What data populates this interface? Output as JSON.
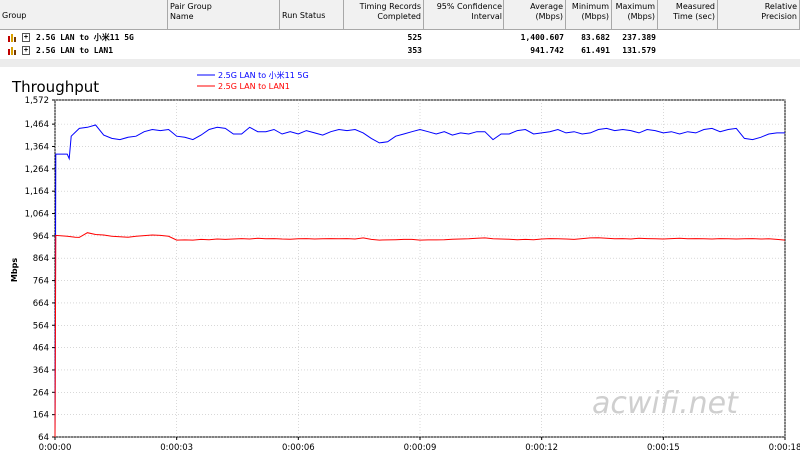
{
  "table": {
    "columns": [
      "Group",
      "Pair Group Name",
      "Run Status",
      "Timing Records Completed",
      "95% Confidence Interval",
      "Average (Mbps)",
      "Minimum (Mbps)",
      "Maximum (Mbps)",
      "Measured Time (sec)",
      "Relative Precision"
    ],
    "rows": [
      {
        "name": "2.5G LAN to 小米11 5G",
        "expand": "+",
        "records": "525",
        "average": "1,400.607",
        "minimum": "83.682",
        "maximum": "237.389"
      },
      {
        "name": "2.5G LAN to LAN1",
        "expand": "+",
        "records": "353",
        "average": "941.742",
        "minimum": "61.491",
        "maximum": "131.579"
      }
    ]
  },
  "chart_data": {
    "type": "line",
    "title": "Throughput",
    "xlabel": "",
    "ylabel": "Mbps",
    "ylim": [
      64,
      1572
    ],
    "yticks": [
      "1,572",
      "1,464",
      "1,364",
      "1,264",
      "1,164",
      "1,064",
      "964",
      "864",
      "764",
      "664",
      "564",
      "464",
      "364",
      "264",
      "164",
      "64"
    ],
    "xticks": [
      "0:00:00",
      "0:00:03",
      "0:00:06",
      "0:00:09",
      "0:00:12",
      "0:00:15",
      "0:00:18"
    ],
    "legend_position": "top-center",
    "grid": true,
    "series": [
      {
        "name": "2.5G LAN to 小米11 5G",
        "color": "#0000ff",
        "points": [
          [
            0,
            64
          ],
          [
            0.02,
            1330
          ],
          [
            0.3,
            1330
          ],
          [
            0.35,
            1310
          ],
          [
            0.4,
            1410
          ],
          [
            0.6,
            1445
          ],
          [
            0.8,
            1450
          ],
          [
            1.0,
            1460
          ],
          [
            1.2,
            1415
          ],
          [
            1.4,
            1400
          ],
          [
            1.6,
            1395
          ],
          [
            1.8,
            1405
          ],
          [
            2.0,
            1410
          ],
          [
            2.2,
            1430
          ],
          [
            2.4,
            1440
          ],
          [
            2.6,
            1435
          ],
          [
            2.8,
            1440
          ],
          [
            3.0,
            1410
          ],
          [
            3.2,
            1405
          ],
          [
            3.4,
            1395
          ],
          [
            3.6,
            1415
          ],
          [
            3.8,
            1440
          ],
          [
            4.0,
            1450
          ],
          [
            4.2,
            1445
          ],
          [
            4.4,
            1420
          ],
          [
            4.6,
            1420
          ],
          [
            4.8,
            1450
          ],
          [
            5.0,
            1430
          ],
          [
            5.2,
            1430
          ],
          [
            5.4,
            1440
          ],
          [
            5.6,
            1420
          ],
          [
            5.8,
            1430
          ],
          [
            6.0,
            1420
          ],
          [
            6.2,
            1435
          ],
          [
            6.4,
            1425
          ],
          [
            6.6,
            1415
          ],
          [
            6.8,
            1430
          ],
          [
            7.0,
            1440
          ],
          [
            7.2,
            1435
          ],
          [
            7.4,
            1440
          ],
          [
            7.6,
            1425
          ],
          [
            7.8,
            1400
          ],
          [
            8.0,
            1380
          ],
          [
            8.2,
            1385
          ],
          [
            8.4,
            1410
          ],
          [
            8.6,
            1420
          ],
          [
            8.8,
            1430
          ],
          [
            9.0,
            1440
          ],
          [
            9.2,
            1430
          ],
          [
            9.4,
            1420
          ],
          [
            9.6,
            1430
          ],
          [
            9.8,
            1415
          ],
          [
            10.0,
            1425
          ],
          [
            10.2,
            1420
          ],
          [
            10.4,
            1430
          ],
          [
            10.6,
            1430
          ],
          [
            10.8,
            1395
          ],
          [
            11.0,
            1420
          ],
          [
            11.2,
            1420
          ],
          [
            11.4,
            1435
          ],
          [
            11.6,
            1440
          ],
          [
            11.8,
            1420
          ],
          [
            12.0,
            1425
          ],
          [
            12.2,
            1430
          ],
          [
            12.4,
            1440
          ],
          [
            12.6,
            1425
          ],
          [
            12.8,
            1430
          ],
          [
            13.0,
            1420
          ],
          [
            13.2,
            1425
          ],
          [
            13.4,
            1440
          ],
          [
            13.6,
            1445
          ],
          [
            13.8,
            1435
          ],
          [
            14.0,
            1440
          ],
          [
            14.2,
            1435
          ],
          [
            14.4,
            1425
          ],
          [
            14.6,
            1440
          ],
          [
            14.8,
            1435
          ],
          [
            15.0,
            1425
          ],
          [
            15.2,
            1430
          ],
          [
            15.4,
            1420
          ],
          [
            15.6,
            1430
          ],
          [
            15.8,
            1425
          ],
          [
            16.0,
            1440
          ],
          [
            16.2,
            1445
          ],
          [
            16.4,
            1430
          ],
          [
            16.6,
            1440
          ],
          [
            16.8,
            1445
          ],
          [
            17.0,
            1400
          ],
          [
            17.2,
            1395
          ],
          [
            17.4,
            1405
          ],
          [
            17.6,
            1420
          ],
          [
            17.8,
            1425
          ],
          [
            18.0,
            1425
          ]
        ]
      },
      {
        "name": "2.5G LAN to LAN1",
        "color": "#ff0000",
        "points": [
          [
            0,
            64
          ],
          [
            0.02,
            966
          ],
          [
            0.3,
            962
          ],
          [
            0.5,
            958
          ],
          [
            0.6,
            957
          ],
          [
            0.8,
            978
          ],
          [
            1.0,
            970
          ],
          [
            1.2,
            968
          ],
          [
            1.4,
            962
          ],
          [
            1.6,
            960
          ],
          [
            1.8,
            958
          ],
          [
            2.0,
            962
          ],
          [
            2.2,
            965
          ],
          [
            2.4,
            968
          ],
          [
            2.6,
            966
          ],
          [
            2.8,
            962
          ],
          [
            3.0,
            945
          ],
          [
            3.2,
            946
          ],
          [
            3.4,
            945
          ],
          [
            3.6,
            948
          ],
          [
            3.8,
            947
          ],
          [
            4.0,
            950
          ],
          [
            4.2,
            948
          ],
          [
            4.4,
            950
          ],
          [
            4.6,
            952
          ],
          [
            4.8,
            950
          ],
          [
            5.0,
            953
          ],
          [
            5.2,
            951
          ],
          [
            5.4,
            952
          ],
          [
            5.6,
            950
          ],
          [
            5.8,
            949
          ],
          [
            6.0,
            951
          ],
          [
            6.2,
            952
          ],
          [
            6.4,
            950
          ],
          [
            6.6,
            951
          ],
          [
            6.8,
            952
          ],
          [
            7.0,
            951
          ],
          [
            7.2,
            952
          ],
          [
            7.4,
            950
          ],
          [
            7.6,
            955
          ],
          [
            7.8,
            948
          ],
          [
            8.0,
            945
          ],
          [
            8.2,
            946
          ],
          [
            8.4,
            947
          ],
          [
            8.6,
            948
          ],
          [
            8.8,
            948
          ],
          [
            9.0,
            945
          ],
          [
            9.2,
            946
          ],
          [
            9.4,
            946
          ],
          [
            9.6,
            947
          ],
          [
            9.8,
            949
          ],
          [
            10.0,
            950
          ],
          [
            10.2,
            951
          ],
          [
            10.4,
            953
          ],
          [
            10.6,
            955
          ],
          [
            10.8,
            951
          ],
          [
            11.0,
            950
          ],
          [
            11.2,
            949
          ],
          [
            11.4,
            947
          ],
          [
            11.6,
            948
          ],
          [
            11.8,
            947
          ],
          [
            12.0,
            950
          ],
          [
            12.2,
            952
          ],
          [
            12.4,
            951
          ],
          [
            12.6,
            950
          ],
          [
            12.8,
            948
          ],
          [
            13.0,
            952
          ],
          [
            13.2,
            955
          ],
          [
            13.4,
            956
          ],
          [
            13.6,
            953
          ],
          [
            13.8,
            951
          ],
          [
            14.0,
            952
          ],
          [
            14.2,
            950
          ],
          [
            14.4,
            953
          ],
          [
            14.6,
            952
          ],
          [
            14.8,
            951
          ],
          [
            15.0,
            950
          ],
          [
            15.2,
            952
          ],
          [
            15.4,
            953
          ],
          [
            15.6,
            951
          ],
          [
            15.8,
            952
          ],
          [
            16.0,
            951
          ],
          [
            16.2,
            950
          ],
          [
            16.4,
            952
          ],
          [
            16.6,
            951
          ],
          [
            16.8,
            950
          ],
          [
            17.0,
            951
          ],
          [
            17.2,
            952
          ],
          [
            17.4,
            950
          ],
          [
            17.6,
            951
          ],
          [
            17.8,
            948
          ],
          [
            18.0,
            945
          ]
        ]
      }
    ]
  },
  "watermark": "acwifi.net"
}
